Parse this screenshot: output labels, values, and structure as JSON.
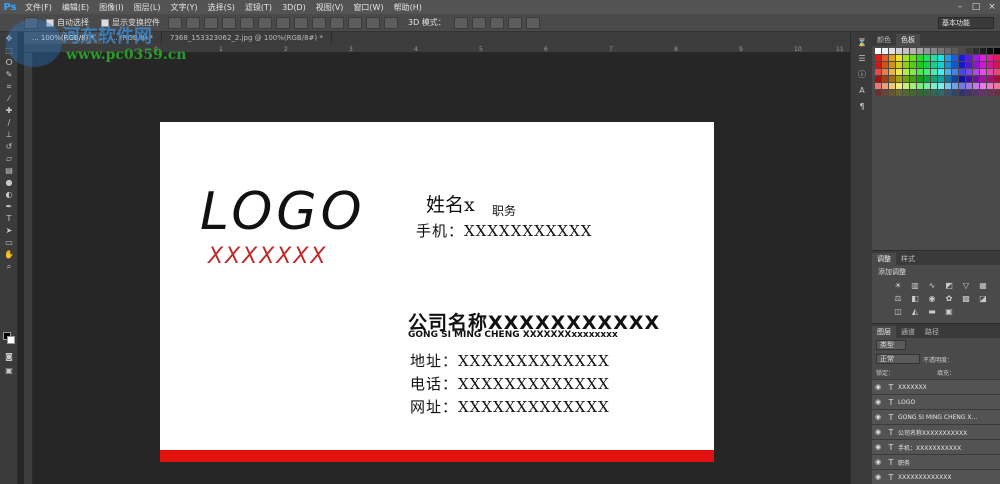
{
  "app": {
    "logo": "Ps",
    "menu": [
      "文件(F)",
      "编辑(E)",
      "图像(I)",
      "图层(L)",
      "文字(Y)",
      "选择(S)",
      "滤镜(T)",
      "3D(D)",
      "视图(V)",
      "窗口(W)",
      "帮助(H)"
    ]
  },
  "options": {
    "auto_select_label": "自动选择",
    "transform_label": "显示变换控件",
    "mode_3d": "3D 模式：",
    "workspace": "基本功能"
  },
  "tabs": [
    {
      "label": "... 100%(RGB/8) *",
      "active": true
    },
    {
      "label": "... (RGB/8) *",
      "active": false
    },
    {
      "label": "7368_153323062_2.jpg @ 100%(RGB/8#) *",
      "active": false
    }
  ],
  "ruler_ticks": [
    "0",
    "1",
    "2",
    "3",
    "4",
    "5",
    "6",
    "7",
    "8",
    "9",
    "10",
    "11"
  ],
  "watermark": {
    "title": "河东软件网",
    "url": "www.pc0359.cn"
  },
  "card": {
    "logo": "LOGO",
    "logo_sub": "XXXXXXX",
    "name": "姓名x",
    "job_title": "职务",
    "phone": "手机：XXXXXXXXXXX",
    "company": "公司名称XXXXXXXXXXX",
    "company_en": "GONG SI MING CHENG XXXXXXXxxxxxxxx",
    "address": "地址：XXXXXXXXXXXXX",
    "tel": "电话：XXXXXXXXXXXXX",
    "website": "网址：XXXXXXXXXXXXX",
    "stripe_color": "#e31010"
  },
  "panels": {
    "swatch_tabs": [
      "颜色",
      "色板"
    ],
    "adjust_tabs": [
      "调整",
      "样式"
    ],
    "adjust_title": "添加调整",
    "layer_tabs": [
      "图层",
      "通道",
      "路径"
    ],
    "filter_kind": "类型",
    "blend_mode": "正常",
    "opacity_label": "不透明度：",
    "lock_label": "锁定：",
    "fill_label": "填充：",
    "layers": [
      "XXXXXXX",
      "LOGO",
      "GONG SI MING CHENG X...",
      "公司名称XXXXXXXXXXX",
      "手机：XXXXXXXXXXX",
      "职务",
      "XXXXXXXXXXXXX"
    ]
  }
}
